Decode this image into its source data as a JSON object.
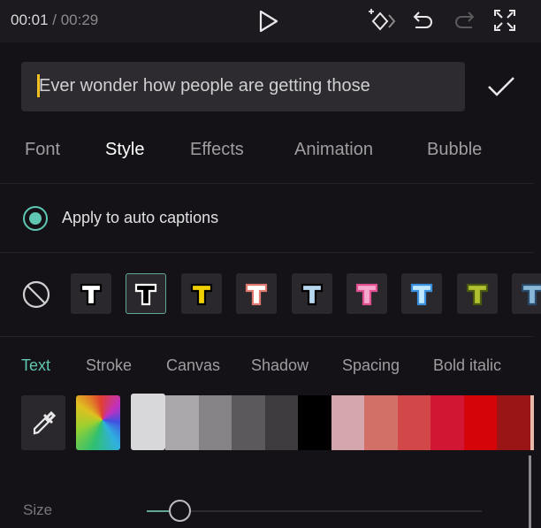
{
  "player": {
    "current_time": "00:01",
    "separator": " / ",
    "total_time": "00:29"
  },
  "editor": {
    "text": "Ever wonder how people are getting those"
  },
  "tabs": [
    {
      "label": "Font"
    },
    {
      "label": "Style",
      "active": true
    },
    {
      "label": "Effects"
    },
    {
      "label": "Animation"
    },
    {
      "label": "Bubble"
    }
  ],
  "auto_captions": {
    "label": "Apply to auto captions",
    "checked": true
  },
  "styles": [
    {
      "fill": "#ffffff",
      "stroke": "#000000"
    },
    {
      "fill": "#000000",
      "stroke": "#ffffff",
      "selected": true
    },
    {
      "fill": "#f0d000",
      "stroke": "#000000"
    },
    {
      "fill": "#ffffff",
      "stroke": "#e07a70"
    },
    {
      "fill": "#b8d8f0",
      "stroke": "#000000"
    },
    {
      "fill": "#f4a8cc",
      "stroke": "#e05090"
    },
    {
      "fill": "#bfe8ff",
      "stroke": "#3a90e0"
    },
    {
      "fill": "#b0c030",
      "stroke": "#4a5a10"
    },
    {
      "fill": "#8ab8d8",
      "stroke": "#2a4a6a"
    }
  ],
  "subtabs": [
    {
      "label": "Text",
      "active": true
    },
    {
      "label": "Stroke"
    },
    {
      "label": "Canvas"
    },
    {
      "label": "Shadow"
    },
    {
      "label": "Spacing"
    },
    {
      "label": "Bold italic"
    }
  ],
  "colors": [
    "#d8d7da",
    "#a9a7aa",
    "#858386",
    "#5b595c",
    "#3d3b3e",
    "#000000",
    "#d6a6ae",
    "#d27068",
    "#d24848",
    "#d01632",
    "#d40408",
    "#9a1616",
    "#e8b8a8"
  ],
  "size": {
    "label": "Size",
    "value_percent": 10
  },
  "accent": "#5fc7b2"
}
